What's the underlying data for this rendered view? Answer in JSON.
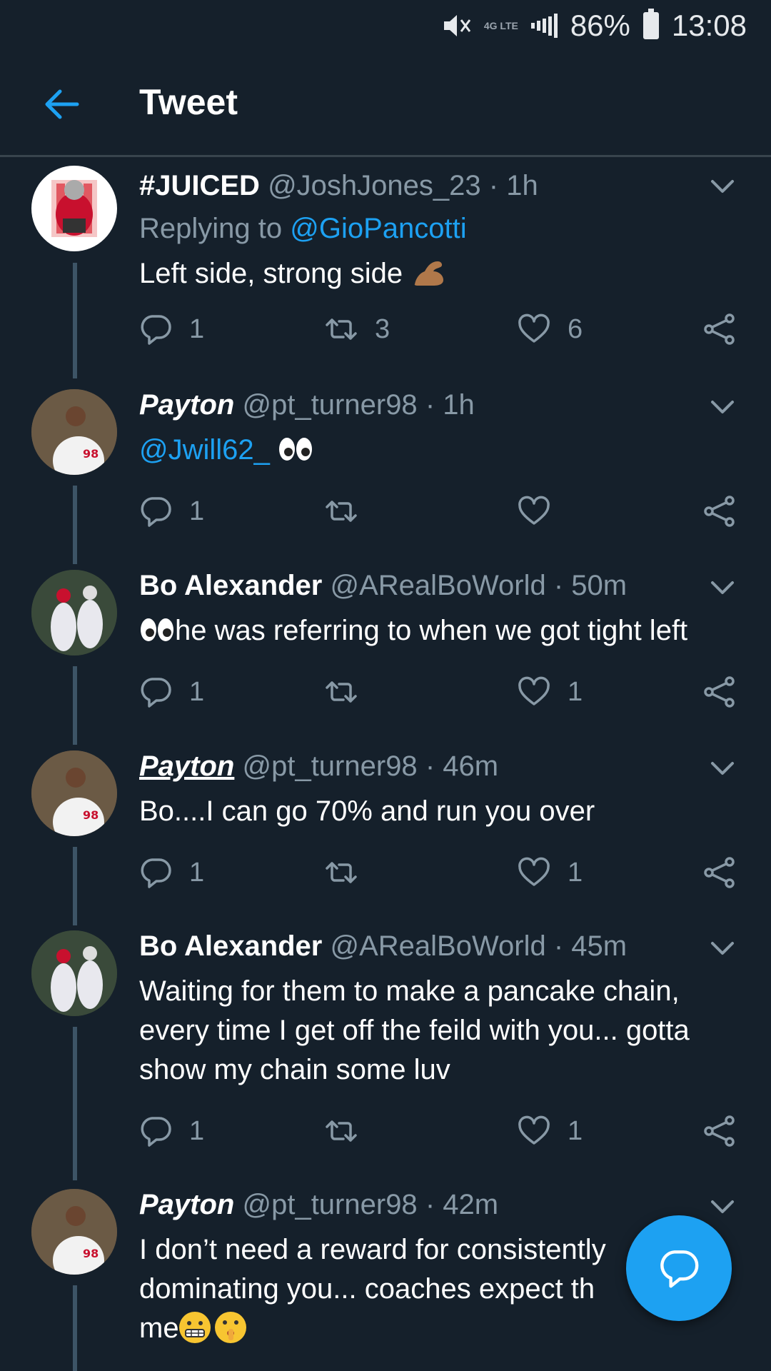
{
  "status_bar": {
    "battery": "86%",
    "time": "13:08",
    "network": "4G LTE"
  },
  "header": {
    "title": "Tweet",
    "back_icon": "arrow-left-icon"
  },
  "colors": {
    "background": "#15202b",
    "accent": "#1da1f2",
    "muted": "#8899a6"
  },
  "tweets": [
    {
      "name": "#JUICED",
      "handle": "@JoshJones_23",
      "time": "· 1h",
      "replying_prefix": "Replying to ",
      "replying_to": "@GioPancotti",
      "text": "Left side, strong side",
      "emoji": "flexed-biceps",
      "replies": "1",
      "retweets": "3",
      "likes": "6"
    },
    {
      "name": "Payton",
      "handle": "@pt_turner98",
      "time": "· 1h",
      "mention": "@Jwill62_",
      "emoji": "eyes",
      "replies": "1",
      "retweets": "",
      "likes": ""
    },
    {
      "name": "Bo Alexander",
      "handle": "@ARealBoWorld",
      "time": "· 50m",
      "text": "he was referring to when we got tight left",
      "emoji": "eyes",
      "replies": "1",
      "retweets": "",
      "likes": "1"
    },
    {
      "name": "Payton",
      "handle": "@pt_turner98",
      "time": "· 46m",
      "text": "Bo....I can go 70% and run you over",
      "replies": "1",
      "retweets": "",
      "likes": "1"
    },
    {
      "name": "Bo Alexander",
      "handle": "@ARealBoWorld",
      "time": "· 45m",
      "text_lines": [
        "Waiting for them to make a pancake chain,",
        "every time I get off the feild with you... gotta",
        "show my chain some luv"
      ],
      "replies": "1",
      "retweets": "",
      "likes": "1"
    },
    {
      "name": "Payton",
      "handle": "@pt_turner98",
      "time": "· 42m",
      "text_lines": [
        "I don’t need a reward for consistently",
        "dominating you... coaches expect th",
        "me"
      ],
      "emoji": "grimacing, shushing"
    }
  ]
}
